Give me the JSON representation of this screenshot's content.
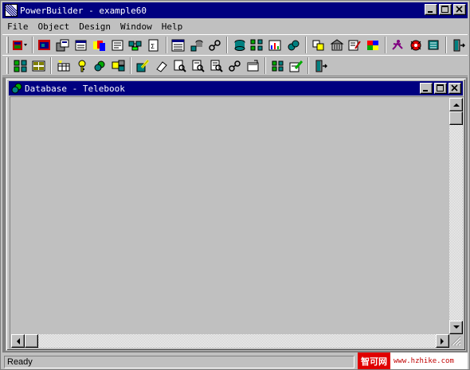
{
  "app": {
    "title": "PowerBuilder - example60"
  },
  "menu": [
    "File",
    "Object",
    "Design",
    "Window",
    "Help"
  ],
  "toolbar1": {
    "icons": [
      "application-icon",
      "window-icon",
      "menu-icon",
      "datawindow-icon",
      "structure-icon",
      "user-object-icon",
      "function-icon",
      "query-icon",
      "pipeline-icon",
      "database-icon",
      "database-profile-icon",
      "library-icon",
      "run-icon",
      "debug-icon",
      "stop-icon",
      "exit-icon"
    ]
  },
  "toolbar2": {
    "icons": [
      "table-icon",
      "layout-icon",
      "create-table-icon",
      "key-icon",
      "index-icon",
      "view-icon",
      "edit-data-icon",
      "erase-icon",
      "preview-icon",
      "log-icon",
      "log-begin-icon",
      "log-export-icon",
      "properties-icon",
      "columns-icon",
      "edit-pencil-icon",
      "close-painter-icon"
    ]
  },
  "child_window": {
    "title": "Database - Telebook"
  },
  "status": {
    "text": "Ready"
  },
  "watermark": {
    "logo": "智可网",
    "url": "www.hzhike.com"
  },
  "colors": {
    "titlebar": "#000080",
    "face": "#c0c0c0",
    "mdi_background": "#808080",
    "watermark_red": "#e00000"
  }
}
